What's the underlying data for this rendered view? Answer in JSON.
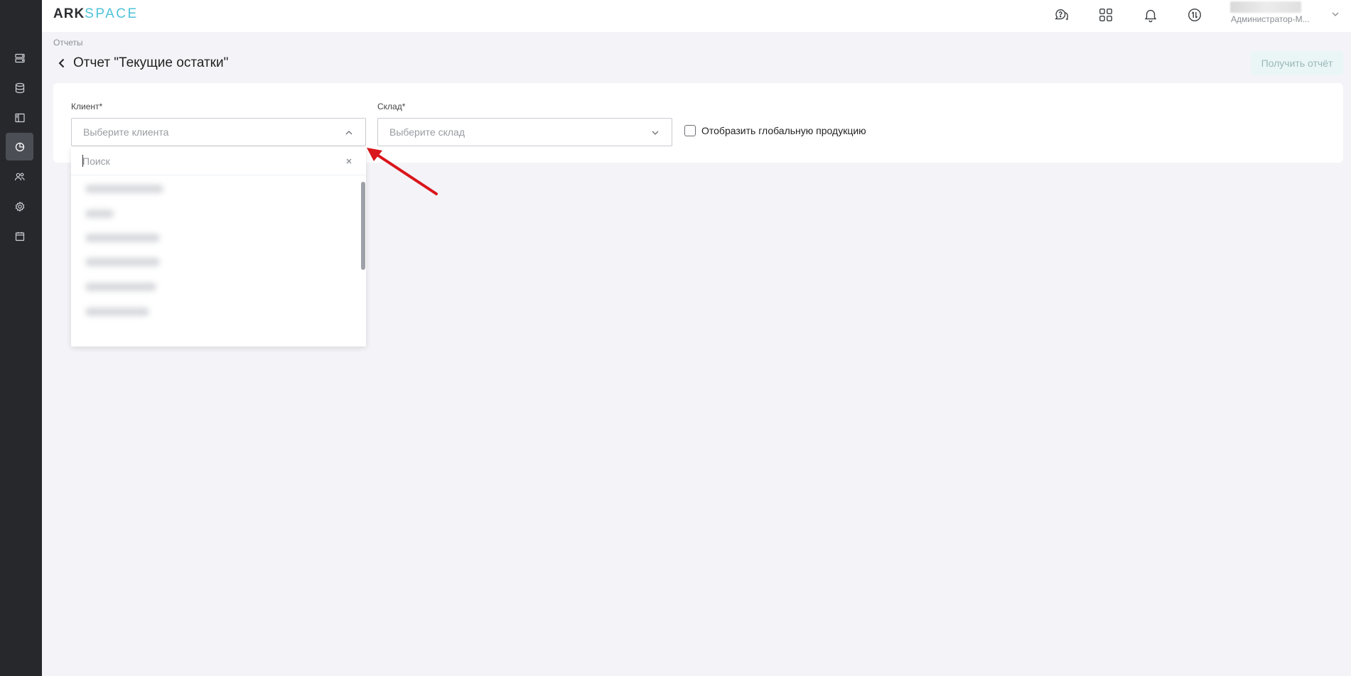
{
  "app": {
    "logo_primary": "ARK",
    "logo_secondary": "SPACE",
    "accent_color": "#4fc3d9"
  },
  "sidebar": {
    "items": [
      {
        "icon": "server-icon",
        "active": false
      },
      {
        "icon": "database-icon",
        "active": false
      },
      {
        "icon": "layout-icon",
        "active": false
      },
      {
        "icon": "pie-chart-icon",
        "active": true
      },
      {
        "icon": "users-icon",
        "active": false
      },
      {
        "icon": "gear-icon",
        "active": false
      },
      {
        "icon": "calendar-icon",
        "active": false
      }
    ]
  },
  "topbar": {
    "icons": [
      "help-chat-icon",
      "apps-grid-icon",
      "bell-icon",
      "exchange-icon"
    ],
    "user_role": "Администратор-М..."
  },
  "breadcrumb": "Отчеты",
  "page": {
    "title": "Отчет \"Текущие остатки\"",
    "get_report_label": "Получить отчёт"
  },
  "form": {
    "client_label": "Клиент*",
    "client_placeholder": "Выберите клиента",
    "warehouse_label": "Склад*",
    "warehouse_placeholder": "Выберите склад",
    "global_products_label": "Отобразить глобальную продукцию",
    "global_products_checked": false
  },
  "dropdown": {
    "search_placeholder": "Поиск",
    "items_blurred": true
  },
  "annotation": {
    "arrow_color": "#d9161c"
  }
}
